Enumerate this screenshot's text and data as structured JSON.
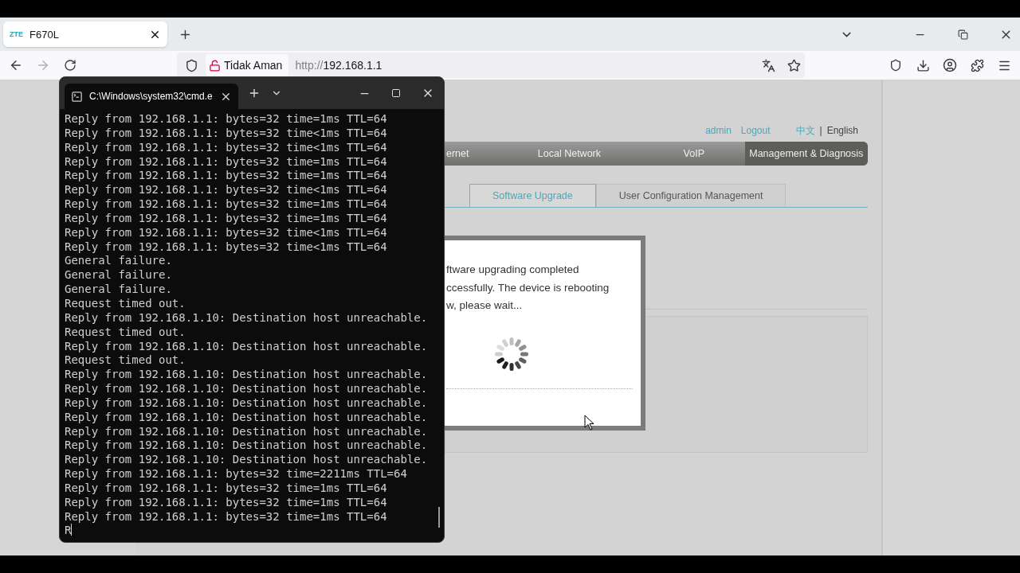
{
  "browser": {
    "tabs": [
      {
        "logo": "ZTE",
        "title": "F670L",
        "selected": true
      }
    ],
    "address": {
      "security": "Tidak Aman",
      "scheme": "http://",
      "host": "192.168.1.1"
    }
  },
  "router": {
    "user_links": [
      "admin",
      "Logout"
    ],
    "languages": [
      {
        "label": "中文",
        "selected": false
      },
      {
        "label": "English",
        "selected": true
      }
    ],
    "language_separator": "|",
    "nav": [
      {
        "label": "ernet",
        "selected": false
      },
      {
        "label": "Local Network",
        "selected": false
      },
      {
        "label": "VoIP",
        "selected": false
      },
      {
        "label": "Management & Diagnosis",
        "selected": true
      }
    ],
    "subtabs": [
      {
        "label": "Software Upgrade",
        "selected": true
      },
      {
        "label": "User Configuration Management",
        "selected": false
      }
    ],
    "dialog": {
      "lines": [
        "ftware upgrading completed",
        "ccessfully. The device is rebooting",
        "w, please wait..."
      ]
    }
  },
  "terminal": {
    "title": "C:\\Windows\\system32\\cmd.e",
    "lines": [
      "Reply from 192.168.1.1: bytes=32 time=1ms TTL=64",
      "Reply from 192.168.1.1: bytes=32 time<1ms TTL=64",
      "Reply from 192.168.1.1: bytes=32 time<1ms TTL=64",
      "Reply from 192.168.1.1: bytes=32 time=1ms TTL=64",
      "Reply from 192.168.1.1: bytes=32 time=1ms TTL=64",
      "Reply from 192.168.1.1: bytes=32 time<1ms TTL=64",
      "Reply from 192.168.1.1: bytes=32 time=1ms TTL=64",
      "Reply from 192.168.1.1: bytes=32 time=1ms TTL=64",
      "Reply from 192.168.1.1: bytes=32 time<1ms TTL=64",
      "Reply from 192.168.1.1: bytes=32 time<1ms TTL=64",
      "General failure.",
      "General failure.",
      "General failure.",
      "Request timed out.",
      "Reply from 192.168.1.10: Destination host unreachable.",
      "Request timed out.",
      "Reply from 192.168.1.10: Destination host unreachable.",
      "Request timed out.",
      "Reply from 192.168.1.10: Destination host unreachable.",
      "Reply from 192.168.1.10: Destination host unreachable.",
      "Reply from 192.168.1.10: Destination host unreachable.",
      "Reply from 192.168.1.10: Destination host unreachable.",
      "Reply from 192.168.1.10: Destination host unreachable.",
      "Reply from 192.168.1.10: Destination host unreachable.",
      "Reply from 192.168.1.10: Destination host unreachable.",
      "Reply from 192.168.1.1: bytes=32 time=2211ms TTL=64",
      "Reply from 192.168.1.1: bytes=32 time=1ms TTL=64",
      "Reply from 192.168.1.1: bytes=32 time=1ms TTL=64",
      "Reply from 192.168.1.1: bytes=32 time=1ms TTL=64"
    ],
    "input": "R"
  }
}
